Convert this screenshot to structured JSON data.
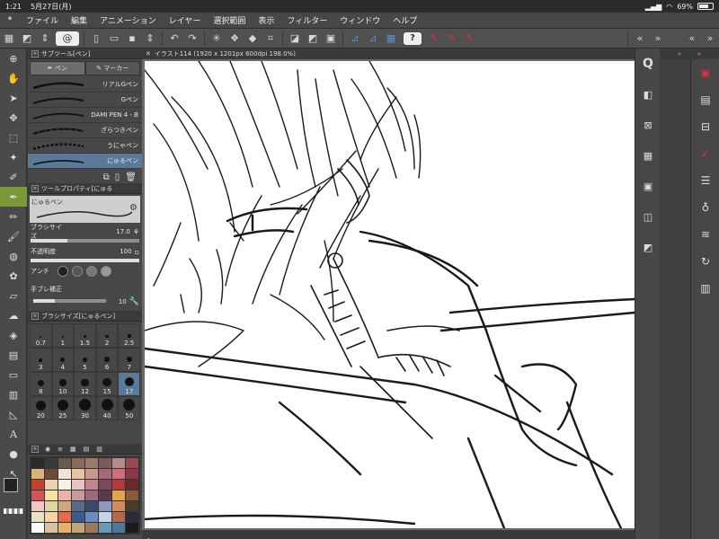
{
  "status": {
    "time": "1:21",
    "date": "5月27日(月)",
    "battery": "69%",
    "battery_level": 0.69
  },
  "menu": [
    "ファイル",
    "編集",
    "アニメーション",
    "レイヤー",
    "選択範囲",
    "表示",
    "フィルター",
    "ウィンドウ",
    "ヘルプ"
  ],
  "subtool": {
    "title": "サブツール[ペン]",
    "tabs": [
      "ペン",
      "マーカー"
    ],
    "brushes": [
      "リアルGペン",
      "Gペン",
      "DAMI PEN 4 - B",
      "ざらつきペン",
      "うにゃペン",
      "にゅるペン"
    ],
    "selected": "にゅるペン"
  },
  "toolprop": {
    "title": "ツールプロパティ[にゅる",
    "preview_label": "にゅるペン",
    "brush_size_label": "ブラシサイズ",
    "brush_size_value": "17.0",
    "opacity_label": "不透明度",
    "opacity_value": "100",
    "aa_label": "アンチ",
    "stabilize_label": "手ブレ補正",
    "stabilize_value": "10"
  },
  "brushsize": {
    "title": "ブラシサイズ[にゅるペン]",
    "sizes": [
      "0.7",
      "1",
      "1.5",
      "2",
      "2.5",
      "3",
      "4",
      "5",
      "6",
      "7",
      "8",
      "10",
      "12",
      "15",
      "17",
      "20",
      "25",
      "30",
      "40",
      "50"
    ],
    "selected": "17"
  },
  "canvas": {
    "tab_title": "イラスト114 (1920 x 1201px 600dpi 198.0%)"
  },
  "colors": {
    "main": "#222222",
    "sub": "#3d8ec9",
    "swatches": [
      "#2b2b2b",
      "#3a3a3a",
      "#6b5a4a",
      "#8a6a58",
      "#9a7a6a",
      "#7a5a5a",
      "#b48a8a",
      "#9a4a4a",
      "#d8b47a",
      "#6a4a3a",
      "#f4e4d4",
      "#e8c4a4",
      "#c89a8a",
      "#a46a7a",
      "#d46a7a",
      "#8a3a4a",
      "#c4442a",
      "#e8d4b4",
      "#f8f4e4",
      "#e4c4c4",
      "#c4848a",
      "#7a4a5a",
      "#b43a3a",
      "#6a2a2a",
      "#d4545a",
      "#f4e4a4",
      "#e8b4a4",
      "#c49a9a",
      "#9a6a7a",
      "#5a3a4a",
      "#e4a44a",
      "#8a5a3a",
      "#f4c4c4",
      "#e4d4a4",
      "#d4a47a",
      "#5a6a8a",
      "#3a4a6a",
      "#8a9aba",
      "#d48a5a",
      "#4a3a2a",
      "#e4e4c4",
      "#f4d4a4",
      "#e46a4a",
      "#3a5a8a",
      "#6a8ac4",
      "#c4d4e4",
      "#b46a4a",
      "#2a2a3a",
      "#fafafa",
      "#d4c4a4",
      "#e4b46a",
      "#c4a47a",
      "#9a7a5a",
      "#6a9aba",
      "#4a7a9a",
      "#1a1a1a"
    ]
  }
}
